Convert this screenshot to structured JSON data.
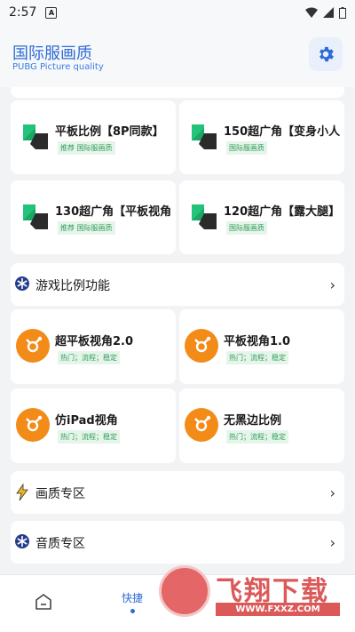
{
  "status_bar": {
    "time": "2:57",
    "notification_letter": "A"
  },
  "header": {
    "title": "国际服画质",
    "subtitle": "PUBG Picture quality",
    "settings_icon": "gear-icon"
  },
  "ratio_tiles": [
    {
      "title": "平板比例【8P同款】",
      "tags": "推荐 国际服画质"
    },
    {
      "title": "150超广角【变身小人",
      "tags": "国际服画质"
    },
    {
      "title": "130超广角【平板视角",
      "tags": "推荐 国际服画质"
    },
    {
      "title": "120超广角【露大腿】",
      "tags": "国际服画质"
    }
  ],
  "game_ratio_section": {
    "label": "游戏比例功能",
    "icon": "snowflake-icon"
  },
  "feature_tiles": [
    {
      "title": "超平板视角2.0",
      "tags": "热门；流程；稳定"
    },
    {
      "title": "平板视角1.0",
      "tags": "热门；流程；稳定"
    },
    {
      "title": "仿iPad视角",
      "tags": "热门；流程；稳定"
    },
    {
      "title": "无黑边比例",
      "tags": "热门；流程；稳定"
    }
  ],
  "quality_section": {
    "label": "画质专区",
    "icon": "lightning-icon"
  },
  "audio_section": {
    "label": "音质专区",
    "icon": "snowflake-icon"
  },
  "bottom_nav": {
    "active_label": "快捷"
  },
  "watermark": {
    "brand": "飞翔下载",
    "url": "WWW.FXXZ.COM"
  },
  "colors": {
    "accent": "#2f6bd6",
    "orange": "#f28b18",
    "tag_green": "#2e9c5b"
  }
}
